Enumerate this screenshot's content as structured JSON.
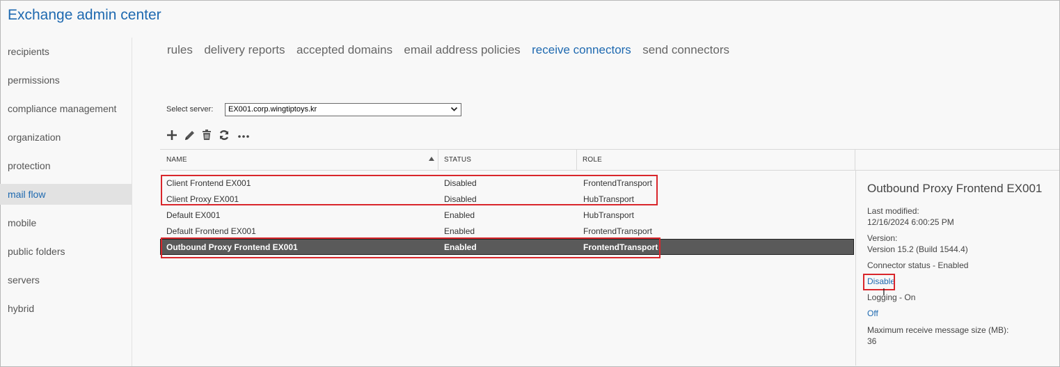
{
  "app": {
    "title": "Exchange admin center"
  },
  "sidebar": {
    "items": [
      {
        "label": "recipients"
      },
      {
        "label": "permissions"
      },
      {
        "label": "compliance management"
      },
      {
        "label": "organization"
      },
      {
        "label": "protection"
      },
      {
        "label": "mail flow",
        "active": true
      },
      {
        "label": "mobile"
      },
      {
        "label": "public folders"
      },
      {
        "label": "servers"
      },
      {
        "label": "hybrid"
      }
    ]
  },
  "tabs": [
    {
      "label": "rules"
    },
    {
      "label": "delivery reports"
    },
    {
      "label": "accepted domains"
    },
    {
      "label": "email address policies"
    },
    {
      "label": "receive connectors",
      "active": true
    },
    {
      "label": "send connectors"
    }
  ],
  "server": {
    "label": "Select server:",
    "value": "EX001.corp.wingtiptoys.kr"
  },
  "toolbar": {
    "icons": [
      "add-icon",
      "edit-icon",
      "delete-icon",
      "refresh-icon",
      "more-icon"
    ]
  },
  "table": {
    "headers": {
      "name": "NAME",
      "status": "STATUS",
      "role": "ROLE"
    },
    "rows": [
      {
        "name": "Client Frontend EX001",
        "status": "Disabled",
        "role": "FrontendTransport"
      },
      {
        "name": "Client Proxy EX001",
        "status": "Disabled",
        "role": "HubTransport"
      },
      {
        "name": "Default EX001",
        "status": "Enabled",
        "role": "HubTransport"
      },
      {
        "name": "Default Frontend EX001",
        "status": "Enabled",
        "role": "FrontendTransport"
      },
      {
        "name": "Outbound Proxy Frontend EX001",
        "status": "Enabled",
        "role": "FrontendTransport",
        "selected": true
      }
    ]
  },
  "detail": {
    "title": "Outbound Proxy Frontend EX001",
    "last_modified_label": "Last modified:",
    "last_modified_value": "12/16/2024 6:00:25 PM",
    "version_label": "Version:",
    "version_value": "Version 15.2 (Build 1544.4)",
    "connector_status": "Connector status - Enabled",
    "disable_link": "Disable",
    "logging": "Logging - On",
    "off_link": "Off",
    "max_size_label": "Maximum receive message size (MB):",
    "max_size_value": "36"
  },
  "colors": {
    "accent": "#1e69b0",
    "highlight": "#d9262b",
    "selected_row": "#5a5a5a"
  }
}
